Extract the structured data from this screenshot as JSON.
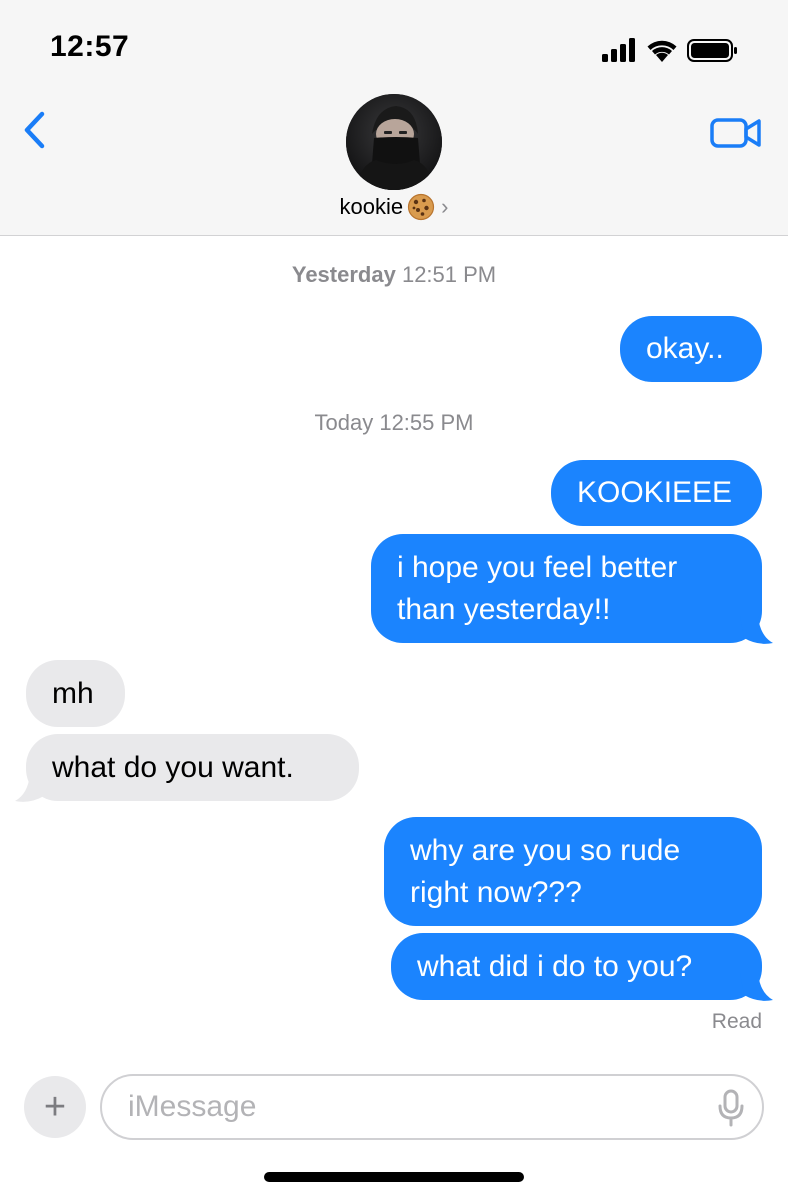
{
  "status_bar": {
    "time": "12:57",
    "icons": [
      "cellular-signal-icon",
      "wifi-icon",
      "battery-icon"
    ]
  },
  "header": {
    "back_icon": "chevron-left-icon",
    "contact_name": "kookie",
    "contact_emoji": "cookie-icon",
    "contact_chevron": "›",
    "facetime_icon": "video-camera-icon"
  },
  "conversation": {
    "timestamp_1": {
      "day": "Yesterday",
      "time": "12:51 PM"
    },
    "timestamp_2": {
      "day": "Today",
      "time": "12:55 PM"
    },
    "messages": [
      {
        "from": "me",
        "text": "okay.."
      },
      {
        "from": "me",
        "text": "KOOKIEEE"
      },
      {
        "from": "me",
        "line1": "i hope you feel better",
        "line2": "than yesterday!!"
      },
      {
        "from": "them",
        "text": "mh"
      },
      {
        "from": "them",
        "text": "what do you want."
      },
      {
        "from": "me",
        "line1": "why are you so rude",
        "line2": "right now???"
      },
      {
        "from": "me",
        "text": "what did i do to you?"
      }
    ],
    "read_receipt": "Read"
  },
  "composer": {
    "plus_label": "+",
    "placeholder": "iMessage",
    "mic_icon": "microphone-icon"
  },
  "colors": {
    "sent_bubble": "#1b84fe",
    "received_bubble": "#e9e9eb",
    "accent": "#1a7df7"
  }
}
